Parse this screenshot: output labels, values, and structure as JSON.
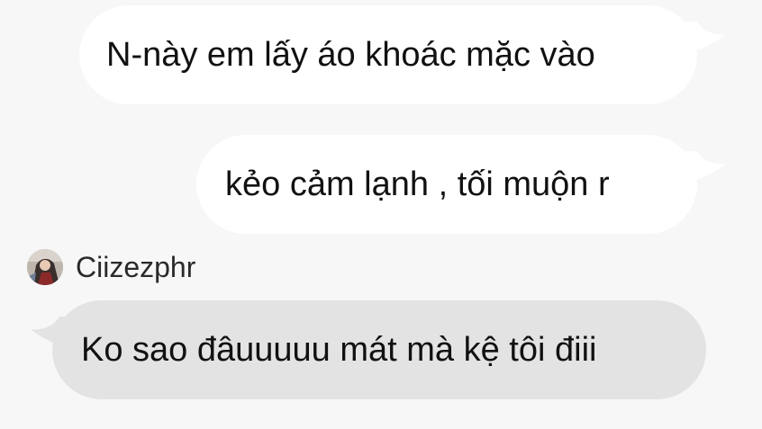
{
  "messages": [
    {
      "direction": "outgoing",
      "text": "N-này em lấy áo khoác mặc vào"
    },
    {
      "direction": "outgoing",
      "text": "kẻo cảm lạnh , tối muộn r"
    },
    {
      "direction": "incoming",
      "sender": "Ciizezphr",
      "text": "Ko sao đâuuuuu mát mà kệ tôi điii"
    }
  ],
  "colors": {
    "background": "#f7f7f7",
    "outgoing_bubble": "#ffffff",
    "incoming_bubble": "#e3e3e3",
    "text": "#111111"
  },
  "icons": {
    "avatar": "user-avatar-photo"
  }
}
